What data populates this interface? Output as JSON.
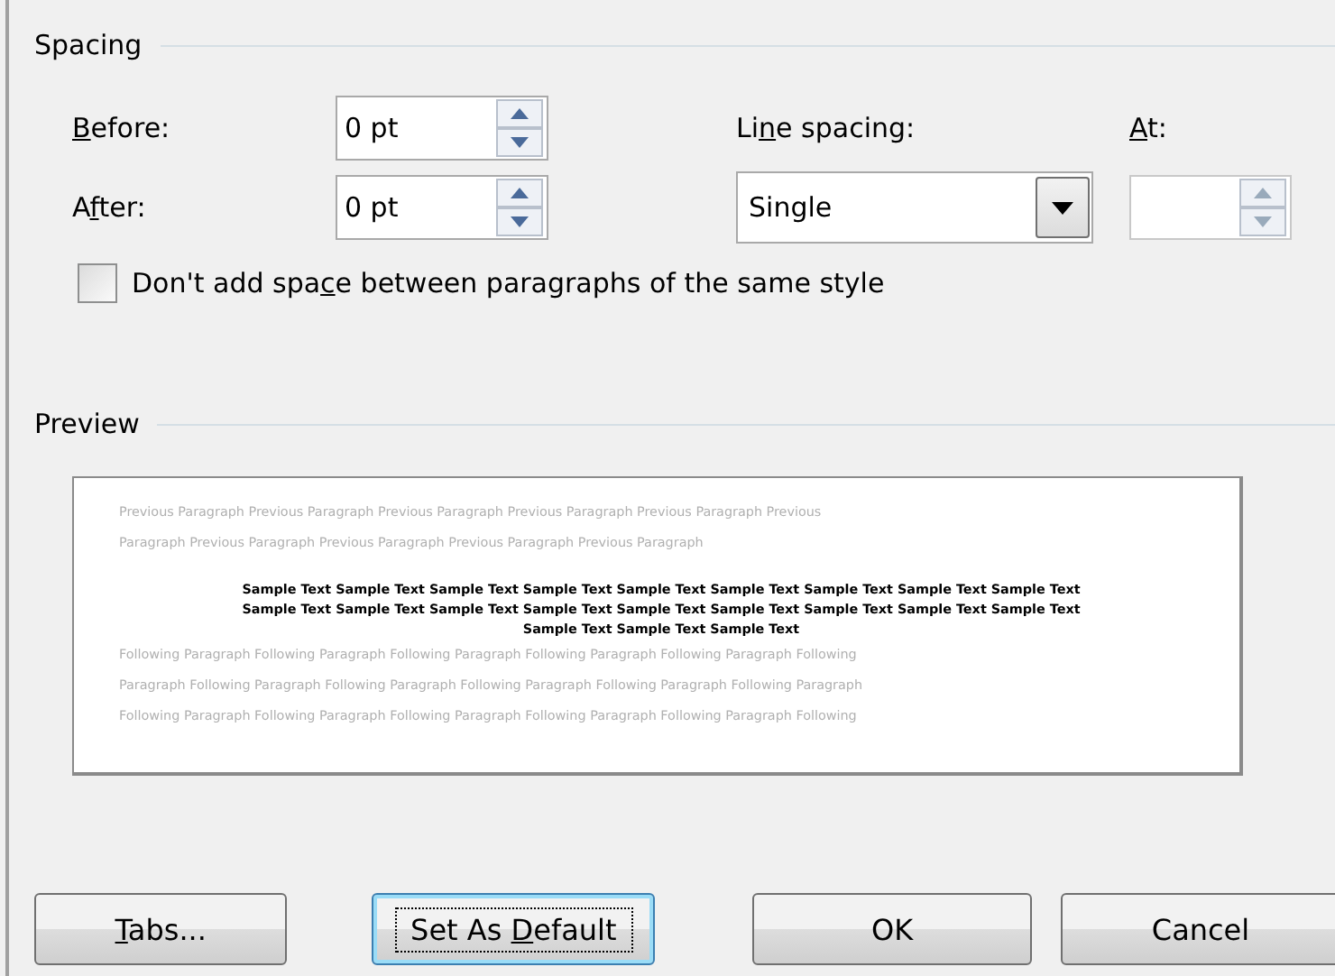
{
  "spacing": {
    "title": "Spacing",
    "before": {
      "label": [
        {
          "text": "B",
          "underlined": true
        },
        {
          "text": "efore:",
          "underlined": false
        }
      ],
      "value": "0 pt"
    },
    "after": {
      "label": [
        {
          "text": "A",
          "underlined": false
        },
        {
          "text": "f",
          "underlined": true
        },
        {
          "text": "ter:",
          "underlined": false
        }
      ],
      "value": "0 pt"
    },
    "line_spacing": {
      "label": [
        {
          "text": "Li",
          "underlined": false
        },
        {
          "text": "n",
          "underlined": true
        },
        {
          "text": "e spacing:",
          "underlined": false
        }
      ],
      "value": "Single"
    },
    "at": {
      "label": [
        {
          "text": "A",
          "underlined": true
        },
        {
          "text": "t:",
          "underlined": false
        }
      ],
      "disabled": true
    },
    "dont_add_space": {
      "label": [
        {
          "text": "Don't add spa",
          "underlined": false
        },
        {
          "text": "c",
          "underlined": true
        },
        {
          "text": "e between paragraphs of the same style",
          "underlined": false
        }
      ],
      "checked": false
    }
  },
  "preview": {
    "title": "Preview",
    "lines": [
      {
        "kind": "previous",
        "text": "Previous Paragraph Previous Paragraph Previous Paragraph Previous Paragraph Previous Paragraph Previous"
      },
      {
        "kind": "previous",
        "text": "Paragraph Previous Paragraph Previous Paragraph Previous Paragraph Previous Paragraph"
      },
      {
        "kind": "sample",
        "text": "Sample Text Sample Text Sample Text Sample Text Sample Text Sample Text Sample Text Sample Text Sample Text"
      },
      {
        "kind": "sample",
        "text": "Sample Text Sample Text Sample Text Sample Text Sample Text Sample Text Sample Text Sample Text Sample Text"
      },
      {
        "kind": "sample",
        "text": "Sample Text Sample Text Sample Text"
      },
      {
        "kind": "following",
        "text": "Following Paragraph Following Paragraph Following Paragraph Following Paragraph Following Paragraph Following"
      },
      {
        "kind": "following",
        "text": "Paragraph Following Paragraph Following Paragraph Following Paragraph Following Paragraph Following Paragraph"
      },
      {
        "kind": "following",
        "text": "Following Paragraph Following Paragraph Following Paragraph Following Paragraph Following Paragraph Following"
      }
    ]
  },
  "buttons": [
    {
      "label": [
        {
          "text": "T",
          "underlined": true
        },
        {
          "text": "abs...",
          "underlined": false
        }
      ],
      "default": false
    },
    {
      "label": [
        {
          "text": "Set As ",
          "underlined": false
        },
        {
          "text": "D",
          "underlined": true
        },
        {
          "text": "efault",
          "underlined": false
        }
      ],
      "default": true
    },
    {
      "label": [
        {
          "text": "OK",
          "underlined": false
        }
      ],
      "default": false
    },
    {
      "label": [
        {
          "text": "Cancel",
          "underlined": false
        }
      ],
      "default": false
    }
  ]
}
